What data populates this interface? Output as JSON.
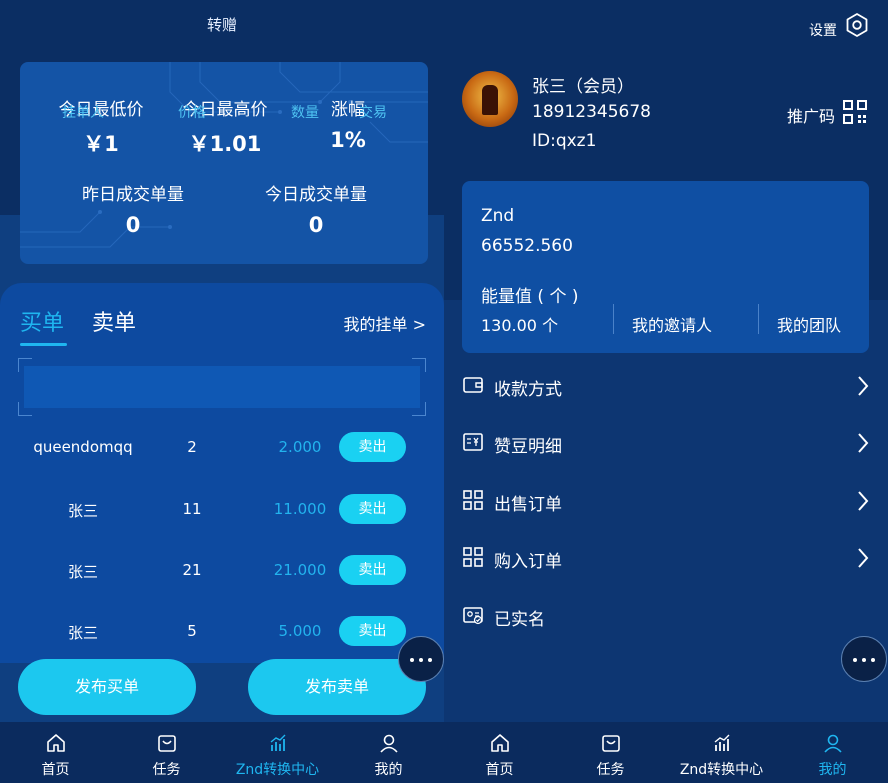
{
  "left": {
    "title": "转赠",
    "stats": {
      "low_label": "今日最低价",
      "low_value": "￥1",
      "high_label": "今日最高价",
      "high_value": "￥1.01",
      "change_label": "涨幅",
      "change_value": "1%",
      "yesterday_label": "昨日成交单量",
      "yesterday_value": "0",
      "today_label": "今日成交单量",
      "today_value": "0"
    },
    "tabs": {
      "buy": "买单",
      "sell": "卖单"
    },
    "my_orders": "我的挂单 >",
    "columns": {
      "user": "挂单人",
      "price": "价格",
      "qty": "数量",
      "trade": "交易"
    },
    "rows": [
      {
        "user": "queendomqq",
        "price": "2",
        "qty": "2.000",
        "action": "卖出"
      },
      {
        "user": "张三",
        "price": "11",
        "qty": "11.000",
        "action": "卖出"
      },
      {
        "user": "张三",
        "price": "21",
        "qty": "21.000",
        "action": "卖出"
      },
      {
        "user": "张三",
        "price": "5",
        "qty": "5.000",
        "action": "卖出"
      }
    ],
    "publish_buy": "发布买单",
    "publish_sell": "发布卖单"
  },
  "right": {
    "settings": "设置",
    "user": {
      "name": "张三（会员）",
      "phone": "18912345678",
      "id": "ID:qxz1"
    },
    "promo": "推广码",
    "asset": {
      "name": "Znd",
      "value": "66552.560",
      "energy_label": "能量值 ( 个 )",
      "energy_value": "130.00 个",
      "inviter": "我的邀请人",
      "team": "我的团队"
    },
    "menu": [
      {
        "label": "收款方式",
        "icon": "wallet-icon",
        "chevron": true
      },
      {
        "label": "赞豆明细",
        "icon": "bill-icon",
        "chevron": true
      },
      {
        "label": "出售订单",
        "icon": "grid-icon",
        "chevron": true
      },
      {
        "label": "购入订单",
        "icon": "grid-icon",
        "chevron": true
      },
      {
        "label": "已实名",
        "icon": "id-card-icon",
        "chevron": false
      }
    ]
  },
  "nav": [
    {
      "label": "首页",
      "icon": "home-icon"
    },
    {
      "label": "任务",
      "icon": "task-icon"
    },
    {
      "label": "Znd转换中心",
      "icon": "chart-icon"
    },
    {
      "label": "我的",
      "icon": "user-icon"
    }
  ],
  "colors": {
    "accent": "#1fb6f0",
    "button": "#1cc8ef",
    "bg_dark": "#0b2e63",
    "card": "#1454a6"
  }
}
